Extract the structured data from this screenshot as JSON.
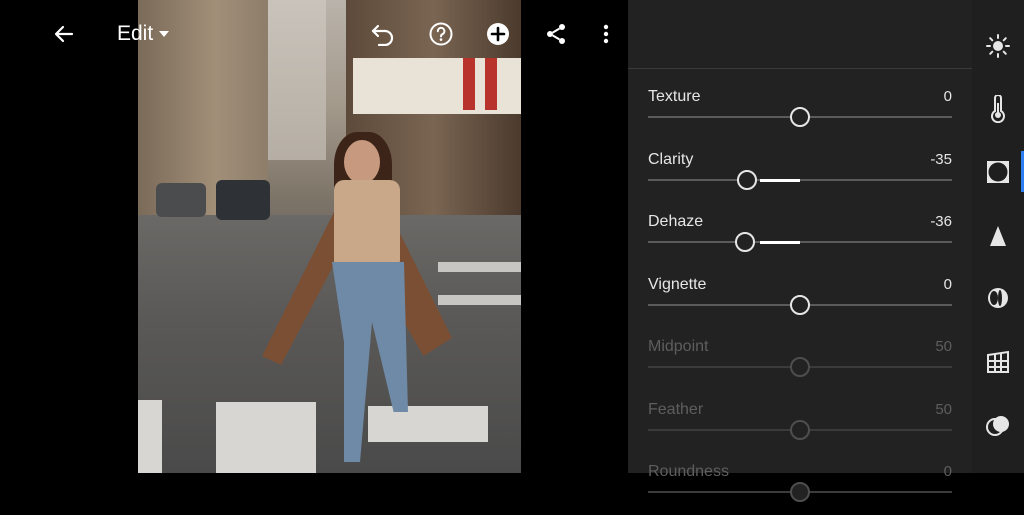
{
  "topbar": {
    "mode_label": "Edit",
    "icons": [
      "back-arrow-icon",
      "undo-icon",
      "help-icon",
      "add-icon",
      "share-icon",
      "more-vertical-icon"
    ]
  },
  "panel": {
    "controls": [
      {
        "label": "Texture",
        "value": "0",
        "pos": 0.5,
        "fill_from": 0.5,
        "fill_to": 0.5,
        "enabled": true
      },
      {
        "label": "Clarity",
        "value": "-35",
        "pos": 0.325,
        "fill_from": 0.37,
        "fill_to": 0.5,
        "enabled": true
      },
      {
        "label": "Dehaze",
        "value": "-36",
        "pos": 0.32,
        "fill_from": 0.37,
        "fill_to": 0.5,
        "enabled": true
      },
      {
        "label": "Vignette",
        "value": "0",
        "pos": 0.5,
        "fill_from": 0.5,
        "fill_to": 0.5,
        "enabled": true
      },
      {
        "label": "Midpoint",
        "value": "50",
        "pos": 0.5,
        "fill_from": 0.5,
        "fill_to": 0.5,
        "enabled": false
      },
      {
        "label": "Feather",
        "value": "50",
        "pos": 0.5,
        "fill_from": 0.5,
        "fill_to": 0.5,
        "enabled": false
      },
      {
        "label": "Roundness",
        "value": "0",
        "pos": 0.5,
        "fill_from": 0.5,
        "fill_to": 0.5,
        "enabled": false
      }
    ]
  },
  "rail": {
    "items": [
      "light-icon",
      "color-temperature-icon",
      "effects-icon",
      "detail-icon",
      "optics-icon",
      "geometry-icon",
      "presets-icon"
    ],
    "active_index": 2,
    "accent_color": "#2b7ff0"
  },
  "colors": {
    "panel_bg": "#222222",
    "rail_bg": "#1f1f1f",
    "track": "#5b5b5b"
  }
}
